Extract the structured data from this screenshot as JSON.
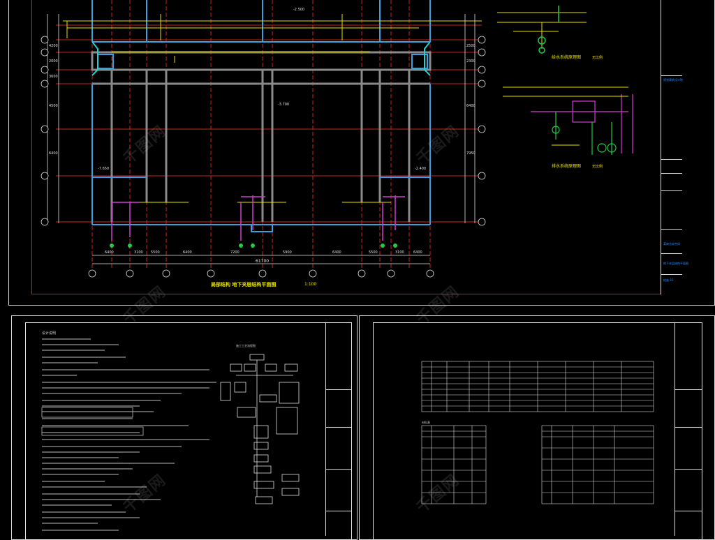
{
  "plan": {
    "title": "局部结构 地下夹层结构平面图",
    "scale": "1:100",
    "total_width": "61700",
    "bottom_dims": [
      "6400",
      "3100",
      "5500",
      "6400",
      "7200",
      "5900",
      "6400",
      "5500",
      "3100",
      "6400"
    ],
    "left_dims": [
      "4200",
      "2000",
      "3600",
      "4500",
      "6400"
    ],
    "right_dims": [
      "2500",
      "2300",
      "6400",
      "7950"
    ],
    "elev_labels": [
      "-2.500",
      "-3.700",
      "-7.650",
      "-2.400"
    ]
  },
  "details": {
    "top_title": "给水系统原理图",
    "top_scale": "无比例",
    "bottom_title": "排水系统原理图",
    "bottom_scale": "无比例"
  },
  "titleblock_top": {
    "company": "规划建筑设计院",
    "project": "某商业综合体",
    "drawing": "地下夹层结构平面图",
    "number": "结施-15"
  },
  "sheet_notes": {
    "title": "设计说明",
    "flow_title": "施工工艺流程图"
  },
  "sheet_table": {
    "title": "材料表"
  },
  "watermark": "千图网",
  "colors": {
    "grid": "#cc2222",
    "wall": "#3aa0e0",
    "beam": "#9a9a9a",
    "dim": "#e0e0e0",
    "yellow": "#e8e000",
    "magenta": "#d23cd2",
    "green": "#22cc44",
    "cyan": "#22d0d0"
  }
}
